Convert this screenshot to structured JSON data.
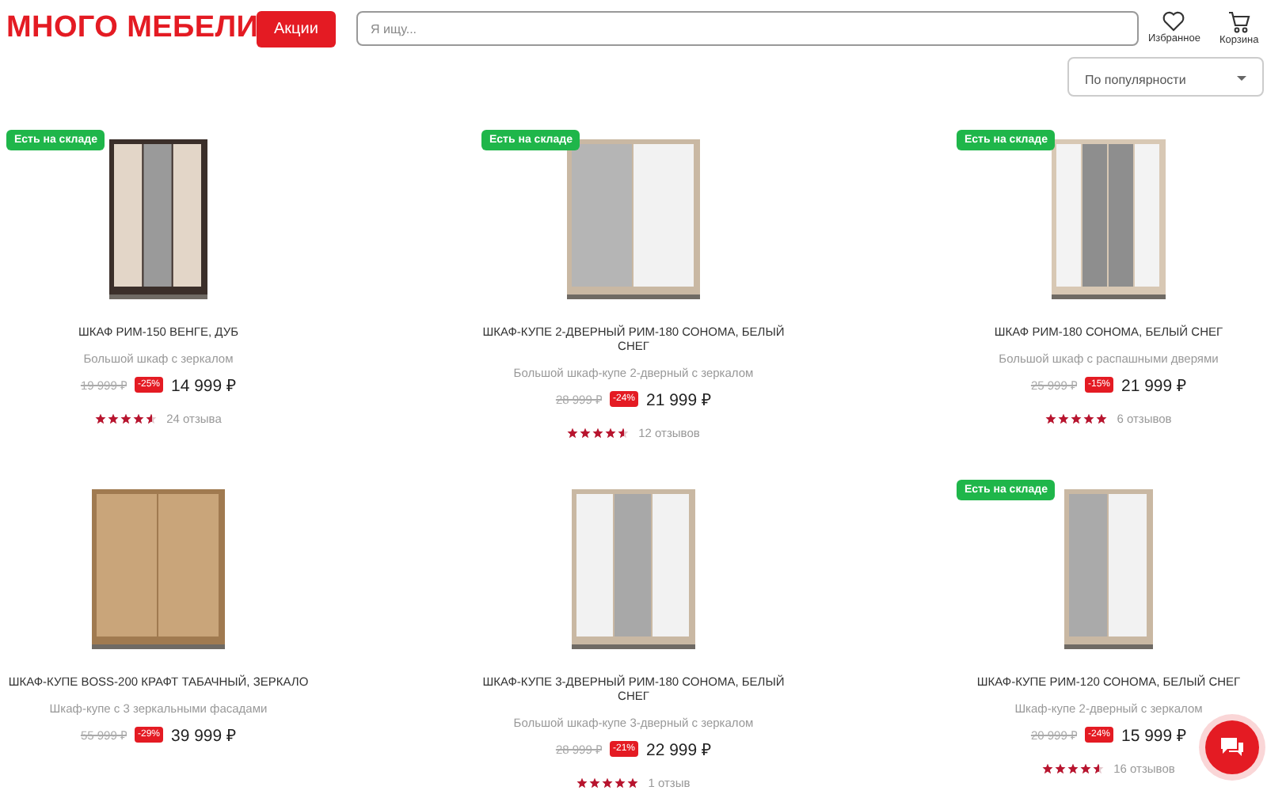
{
  "header": {
    "logo": "МНОГО МЕБЕЛИ",
    "promo_button": "Акции",
    "search": {
      "placeholder": "Я ищу..."
    },
    "actions": [
      {
        "label": "Избранное",
        "kind": "heart"
      },
      {
        "label": "Корзина",
        "kind": "cart"
      }
    ],
    "sort": "По популярности"
  },
  "products": [
    {
      "badge": "Есть на складе",
      "title": "ШКАФ РИМ-150 ВЕНГЕ, ДУБ",
      "description": "Большой шкаф с зеркалом",
      "old_price": "19 999 ₽",
      "discount": "-25%",
      "price": "14 999 ₽",
      "stars": 4.5,
      "reviews": "24 отзыва"
    },
    {
      "badge": "Есть на складе",
      "title": "ШКАФ-КУПЕ 2-ДВЕРНЫЙ РИМ-180 СОНОМА, БЕЛЫЙ СНЕГ",
      "description": "Большой шкаф-купе 2-дверный с зеркалом",
      "old_price": "28 999 ₽",
      "discount": "-24%",
      "price": "21 999 ₽",
      "stars": 4.5,
      "reviews": "12 отзывов"
    },
    {
      "badge": "Есть на складе",
      "title": "ШКАФ РИМ-180 СОНОМА, БЕЛЫЙ СНЕГ",
      "description": "Большой шкаф с распашными дверями",
      "old_price": "25 999 ₽",
      "discount": "-15%",
      "price": "21 999 ₽",
      "stars": 5,
      "reviews": "6 отзывов"
    },
    {
      "title": "ШКАФ-КУПЕ BOSS-200 КРАФТ ТАБАЧНЫЙ, ЗЕРКАЛО",
      "description": "Шкаф-купе с 3 зеркальными фасадами",
      "old_price": "55 999 ₽",
      "discount": "-29%",
      "price": "39 999 ₽"
    },
    {
      "title": "ШКАФ-КУПЕ 3-ДВЕРНЫЙ РИМ-180 СОНОМА, БЕЛЫЙ СНЕГ",
      "description": "Большой шкаф-купе 3-дверный с зеркалом",
      "old_price": "28 999 ₽",
      "discount": "-21%",
      "price": "22 999 ₽",
      "stars": 5,
      "reviews": "1 отзыв"
    },
    {
      "badge": "Есть на складе",
      "title": "ШКАФ-КУПЕ РИМ-120 СОНОМА, БЕЛЫЙ СНЕГ",
      "description": "Шкаф-купе 2-дверный с зеркалом",
      "old_price": "20 999 ₽",
      "discount": "-24%",
      "price": "15 999 ₽",
      "stars": 4.5,
      "reviews": "16 отзывов"
    }
  ]
}
